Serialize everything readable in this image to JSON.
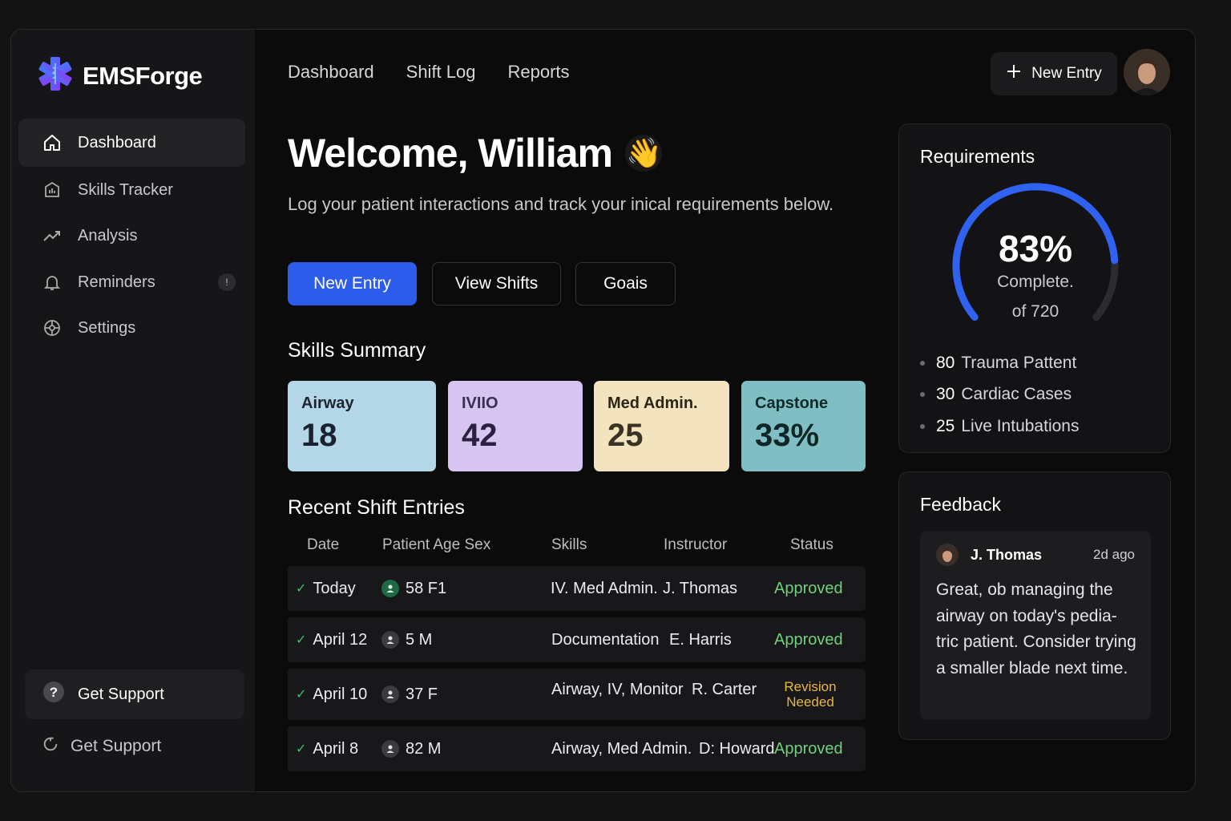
{
  "brand": {
    "name": "EMSForge",
    "logo_icon": "star-of-life-icon"
  },
  "sidebar": {
    "items": [
      {
        "label": "Dashboard",
        "icon": "home-icon",
        "active": true
      },
      {
        "label": "Skills Tracker",
        "icon": "skills-icon"
      },
      {
        "label": "Analysis",
        "icon": "trend-icon"
      },
      {
        "label": "Reminders",
        "icon": "bell-icon",
        "badge": "!"
      },
      {
        "label": "Settings",
        "icon": "gear-icon"
      }
    ],
    "support_box": "Get Support",
    "support_link": "Get Support"
  },
  "topnav": {
    "items": [
      "Dashboard",
      "Shift Log",
      "Reports"
    ],
    "new_entry": "New Entry"
  },
  "welcome": {
    "title": "Welcome, William",
    "emoji": "👋",
    "subtitle": "Log your patient interactions and track your  inical requirements below."
  },
  "actions": {
    "new_entry": "New Entry",
    "view_shifts": "View Shifts",
    "goals": "Goais"
  },
  "skills_summary": {
    "title": "Skills Summary",
    "cards": [
      {
        "label": "Airway",
        "value": "18",
        "color": "#b3d7e6"
      },
      {
        "label": "IVIIO",
        "value": "42",
        "color": "#d6c5f0"
      },
      {
        "label": "Med Admin.",
        "value": "25",
        "color": "#f3e4bf"
      },
      {
        "label": "Capstone",
        "value": "33%",
        "color": "#7fbfc3"
      }
    ]
  },
  "recent": {
    "title": "Recent Shift Entries",
    "columns": [
      "Date",
      "Patient Age Sex",
      "Skills",
      "Instructor",
      "Status"
    ],
    "rows": [
      {
        "date": "Today",
        "patient": "58 F1",
        "skills": "IV. Med Admin.",
        "instructor": "J. Thomas",
        "status": "Approved"
      },
      {
        "date": "April 12",
        "patient": "5 M",
        "skills": "Documentation",
        "instructor": "E. Harris",
        "status": "Approved"
      },
      {
        "date": "April 10",
        "patient": "37 F",
        "skills": "Airway, IV, Monitor",
        "instructor": "R. Carter",
        "status": "Revision Needed"
      },
      {
        "date": "April 8",
        "patient": "82 M",
        "skills": "Airway, Med Admin.",
        "instructor": "D: Howard",
        "status": "Approved"
      }
    ]
  },
  "requirements": {
    "title": "Requirements",
    "percent_value": 0.83,
    "percent": "83%",
    "complete": "Complete.",
    "of": "of 720",
    "items": [
      {
        "num": "80",
        "label": "Trauma Pattent"
      },
      {
        "num": "30",
        "label": "Cardiac Cases"
      },
      {
        "num": "25",
        "label": "Live Intubations"
      }
    ],
    "accent": "#2f62f0"
  },
  "feedback": {
    "title": "Feedback",
    "author": "J. Thomas",
    "time": "2d ago",
    "text": "Great, ob managing the airway on today's pedia-tric patient. Consider trying a smaller blade next time."
  }
}
